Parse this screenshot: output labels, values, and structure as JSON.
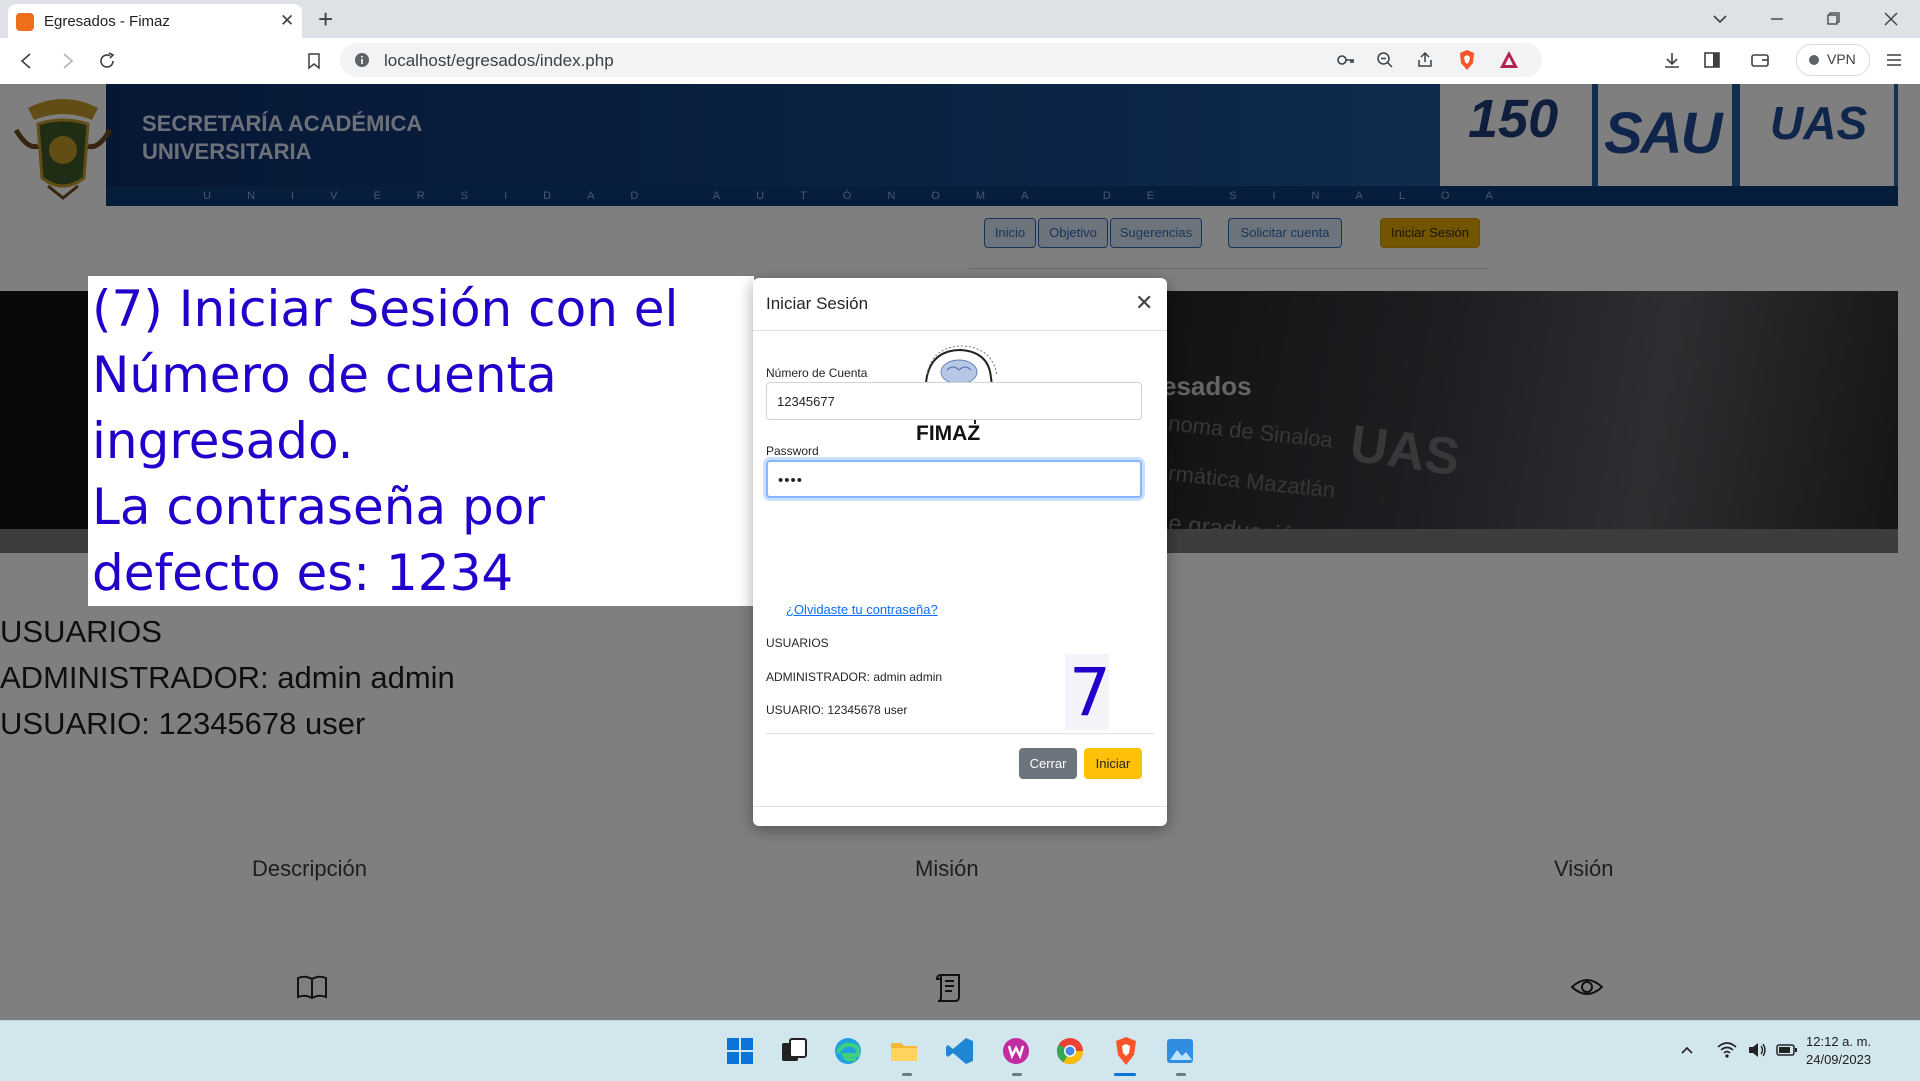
{
  "browser": {
    "tab_title": "Egresados - Fimaz",
    "url": "localhost/egresados/index.php",
    "vpn_label": "VPN"
  },
  "banner": {
    "title_line1": "SECRETARÍA ACADÉMICA",
    "title_line2": "UNIVERSITARIA",
    "strip_text": "UNIVERSIDAD AUTÓNOMA DE SINALOA",
    "logo_150": "150",
    "logo_sau": "SAU",
    "logo_uas": "UAS"
  },
  "nav": {
    "items": [
      "Inicio",
      "Objetivo",
      "Sugerencias",
      "Solicitar cuenta"
    ],
    "login": "Iniciar Sesión"
  },
  "hero": {
    "line1": "esados",
    "line2": "noma de Sinaloa",
    "line3": "rmática Mazatlán",
    "line4": "e graduación",
    "uas": "UAS"
  },
  "users_info": {
    "heading": "USUARIOS",
    "admin": "ADMINISTRADOR: admin admin",
    "user": "USUARIO: 12345678 user"
  },
  "features": {
    "descripcion": "Descripción",
    "mision": "Misión",
    "vision": "Visión"
  },
  "tutorial": {
    "text": "(7) Iniciar Sesión con el\nNúmero de cuenta\ningresado.\nLa contraseña por\ndefecto es: 1234",
    "step": "7"
  },
  "modal": {
    "title": "Iniciar Sesión",
    "logo_text": "FIMAZ",
    "account_label": "Número de Cuenta",
    "account_value": "12345677",
    "password_label": "Password",
    "password_value": "••••",
    "forgot": "¿Olvidaste tu contraseña?",
    "users_heading": "USUARIOS",
    "admin": "ADMINISTRADOR: admin admin",
    "user": "USUARIO: 12345678 user",
    "close_button": "Cerrar",
    "submit_button": "Iniciar"
  },
  "taskbar": {
    "time": "12:12 a. m.",
    "date": "24/09/2023"
  },
  "colors": {
    "accent_blue": "#0d6efd",
    "warning": "#ffc107",
    "banner_blue": "#184a8c",
    "tutorial_text": "#2200cc"
  }
}
